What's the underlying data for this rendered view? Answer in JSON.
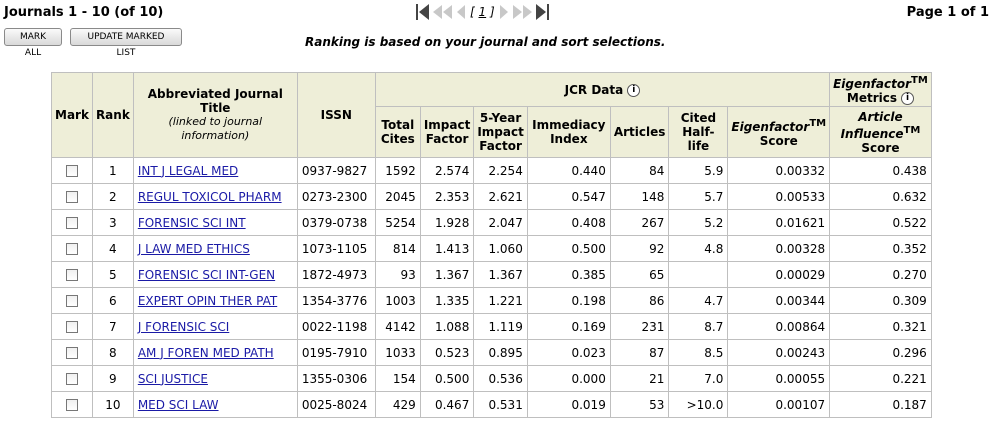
{
  "header": {
    "count_text": "Journals 1 - 10 (of 10)",
    "page_text": "Page 1 of 1",
    "current_page": "1",
    "mark_all_label": "MARK ALL",
    "update_label": "UPDATE MARKED LIST",
    "ranking_message": "Ranking is based on your journal and sort selections."
  },
  "table": {
    "headers": {
      "mark": "Mark",
      "rank": "Rank",
      "title": "Abbreviated Journal Title",
      "title_sub": "(linked to journal information)",
      "issn": "ISSN",
      "jcr_group": "JCR Data",
      "eigen_group": "Eigenfactor",
      "eigen_group_tm": "TM",
      "eigen_group_suffix": " Metrics",
      "total_cites": "Total Cites",
      "impact_factor": "Impact Factor",
      "five_year": "5-Year Impact Factor",
      "immediacy": "Immediacy Index",
      "articles": "Articles",
      "cited_half_life": "Cited Half-life",
      "eigen_score": "Eigenfactor",
      "eigen_score_tm": "TM",
      "eigen_score_suffix": "Score",
      "ai_score": "Article Influence",
      "ai_score_tm": "TM",
      "ai_score_suffix": "Score"
    },
    "rows": [
      {
        "rank": "1",
        "title": "INT J LEGAL MED",
        "issn": "0937-9827",
        "total_cites": "1592",
        "impact_factor": "2.574",
        "five_year": "2.254",
        "immediacy": "0.440",
        "articles": "84",
        "half_life": "5.9",
        "eigenfactor": "0.00332",
        "article_influence": "0.438"
      },
      {
        "rank": "2",
        "title": "REGUL TOXICOL PHARM",
        "issn": "0273-2300",
        "total_cites": "2045",
        "impact_factor": "2.353",
        "five_year": "2.621",
        "immediacy": "0.547",
        "articles": "148",
        "half_life": "5.7",
        "eigenfactor": "0.00533",
        "article_influence": "0.632"
      },
      {
        "rank": "3",
        "title": "FORENSIC SCI INT",
        "issn": "0379-0738",
        "total_cites": "5254",
        "impact_factor": "1.928",
        "five_year": "2.047",
        "immediacy": "0.408",
        "articles": "267",
        "half_life": "5.2",
        "eigenfactor": "0.01621",
        "article_influence": "0.522"
      },
      {
        "rank": "4",
        "title": "J LAW MED ETHICS",
        "issn": "1073-1105",
        "total_cites": "814",
        "impact_factor": "1.413",
        "five_year": "1.060",
        "immediacy": "0.500",
        "articles": "92",
        "half_life": "4.8",
        "eigenfactor": "0.00328",
        "article_influence": "0.352"
      },
      {
        "rank": "5",
        "title": "FORENSIC SCI INT-GEN",
        "issn": "1872-4973",
        "total_cites": "93",
        "impact_factor": "1.367",
        "five_year": "1.367",
        "immediacy": "0.385",
        "articles": "65",
        "half_life": "",
        "eigenfactor": "0.00029",
        "article_influence": "0.270"
      },
      {
        "rank": "6",
        "title": "EXPERT OPIN THER PAT",
        "issn": "1354-3776",
        "total_cites": "1003",
        "impact_factor": "1.335",
        "five_year": "1.221",
        "immediacy": "0.198",
        "articles": "86",
        "half_life": "4.7",
        "eigenfactor": "0.00344",
        "article_influence": "0.309"
      },
      {
        "rank": "7",
        "title": "J FORENSIC SCI",
        "issn": "0022-1198",
        "total_cites": "4142",
        "impact_factor": "1.088",
        "five_year": "1.119",
        "immediacy": "0.169",
        "articles": "231",
        "half_life": "8.7",
        "eigenfactor": "0.00864",
        "article_influence": "0.321"
      },
      {
        "rank": "8",
        "title": "AM J FOREN MED PATH",
        "issn": "0195-7910",
        "total_cites": "1033",
        "impact_factor": "0.523",
        "five_year": "0.895",
        "immediacy": "0.023",
        "articles": "87",
        "half_life": "8.5",
        "eigenfactor": "0.00243",
        "article_influence": "0.296"
      },
      {
        "rank": "9",
        "title": "SCI JUSTICE",
        "issn": "1355-0306",
        "total_cites": "154",
        "impact_factor": "0.500",
        "five_year": "0.536",
        "immediacy": "0.000",
        "articles": "21",
        "half_life": "7.0",
        "eigenfactor": "0.00055",
        "article_influence": "0.221"
      },
      {
        "rank": "10",
        "title": "MED SCI LAW",
        "issn": "0025-8024",
        "total_cites": "429",
        "impact_factor": "0.467",
        "five_year": "0.531",
        "immediacy": "0.019",
        "articles": "53",
        "half_life": ">10.0",
        "eigenfactor": "0.00107",
        "article_influence": "0.187"
      }
    ]
  }
}
